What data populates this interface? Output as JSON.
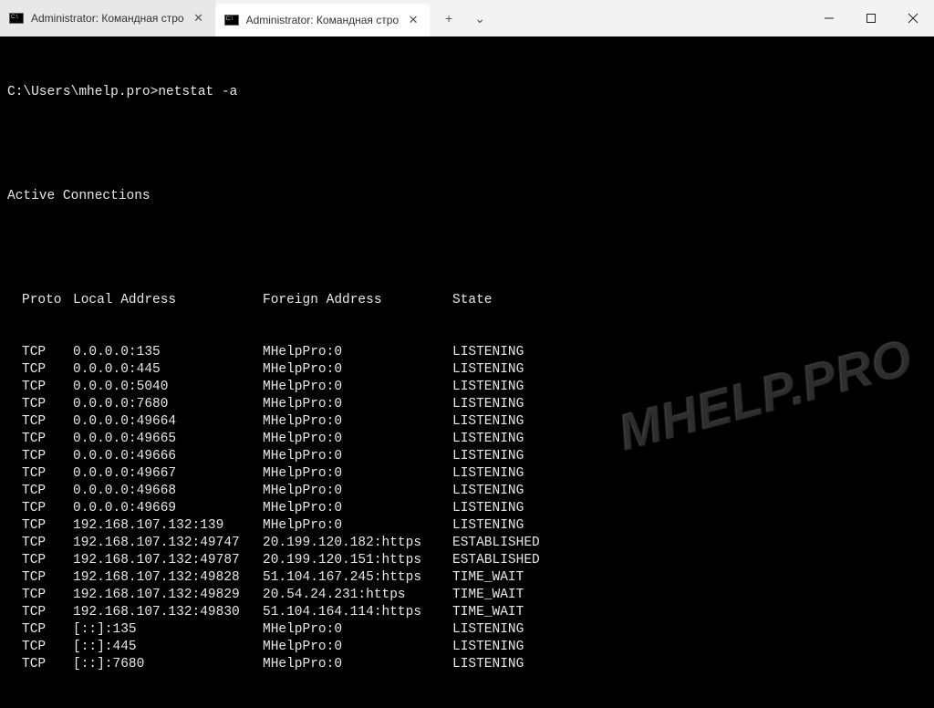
{
  "tabs": [
    {
      "title": "Administrator: Командная стро",
      "active": false
    },
    {
      "title": "Administrator: Командная стро",
      "active": true
    }
  ],
  "prompt": "C:\\Users\\mhelp.pro>netstat -a",
  "section_heading": "Active Connections",
  "columns": {
    "proto": "Proto",
    "local": "Local Address",
    "foreign": "Foreign Address",
    "state": "State"
  },
  "connections": [
    {
      "proto": "TCP",
      "local": "0.0.0.0:135",
      "foreign": "MHelpPro:0",
      "state": "LISTENING"
    },
    {
      "proto": "TCP",
      "local": "0.0.0.0:445",
      "foreign": "MHelpPro:0",
      "state": "LISTENING"
    },
    {
      "proto": "TCP",
      "local": "0.0.0.0:5040",
      "foreign": "MHelpPro:0",
      "state": "LISTENING"
    },
    {
      "proto": "TCP",
      "local": "0.0.0.0:7680",
      "foreign": "MHelpPro:0",
      "state": "LISTENING"
    },
    {
      "proto": "TCP",
      "local": "0.0.0.0:49664",
      "foreign": "MHelpPro:0",
      "state": "LISTENING"
    },
    {
      "proto": "TCP",
      "local": "0.0.0.0:49665",
      "foreign": "MHelpPro:0",
      "state": "LISTENING"
    },
    {
      "proto": "TCP",
      "local": "0.0.0.0:49666",
      "foreign": "MHelpPro:0",
      "state": "LISTENING"
    },
    {
      "proto": "TCP",
      "local": "0.0.0.0:49667",
      "foreign": "MHelpPro:0",
      "state": "LISTENING"
    },
    {
      "proto": "TCP",
      "local": "0.0.0.0:49668",
      "foreign": "MHelpPro:0",
      "state": "LISTENING"
    },
    {
      "proto": "TCP",
      "local": "0.0.0.0:49669",
      "foreign": "MHelpPro:0",
      "state": "LISTENING"
    },
    {
      "proto": "TCP",
      "local": "192.168.107.132:139",
      "foreign": "MHelpPro:0",
      "state": "LISTENING"
    },
    {
      "proto": "TCP",
      "local": "192.168.107.132:49747",
      "foreign": "20.199.120.182:https",
      "state": "ESTABLISHED"
    },
    {
      "proto": "TCP",
      "local": "192.168.107.132:49787",
      "foreign": "20.199.120.151:https",
      "state": "ESTABLISHED"
    },
    {
      "proto": "TCP",
      "local": "192.168.107.132:49828",
      "foreign": "51.104.167.245:https",
      "state": "TIME_WAIT"
    },
    {
      "proto": "TCP",
      "local": "192.168.107.132:49829",
      "foreign": "20.54.24.231:https",
      "state": "TIME_WAIT"
    },
    {
      "proto": "TCP",
      "local": "192.168.107.132:49830",
      "foreign": "51.104.164.114:https",
      "state": "TIME_WAIT"
    },
    {
      "proto": "TCP",
      "local": "[::]:135",
      "foreign": "MHelpPro:0",
      "state": "LISTENING"
    },
    {
      "proto": "TCP",
      "local": "[::]:445",
      "foreign": "MHelpPro:0",
      "state": "LISTENING"
    },
    {
      "proto": "TCP",
      "local": "[::]:7680",
      "foreign": "MHelpPro:0",
      "state": "LISTENING"
    }
  ],
  "watermark": "MHELP.PRO",
  "icons": {
    "plus": "+",
    "chevron": "⌄"
  }
}
